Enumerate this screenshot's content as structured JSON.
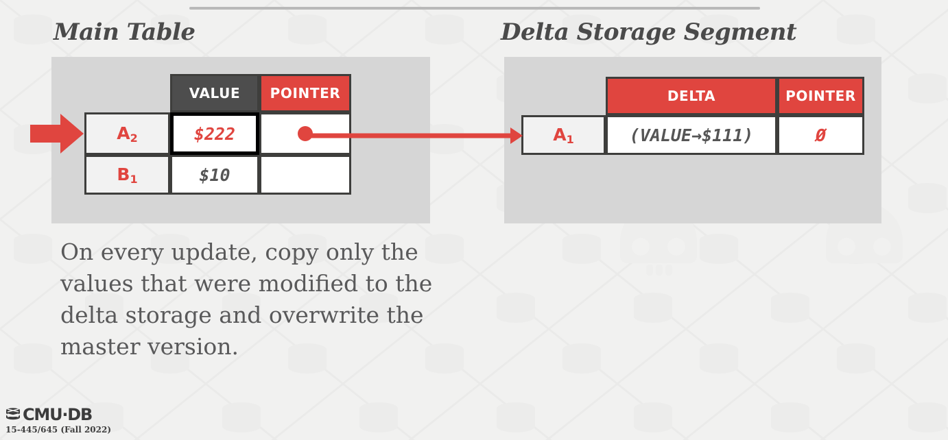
{
  "slide": {
    "footer_wordmark": "CMU·DB",
    "footer_course": "15-445/645 (Fall 2022)",
    "body_text": "On every update, copy only the values that were modified to the delta storage and overwrite the master version."
  },
  "main_table": {
    "title": "Main Table",
    "headers": [
      "",
      "VALUE",
      "POINTER"
    ],
    "rows": [
      {
        "key": "A",
        "key_sub": "2",
        "value": "$222",
        "pointer": "dot"
      },
      {
        "key": "B",
        "key_sub": "1",
        "value": "$10",
        "pointer": ""
      }
    ]
  },
  "delta_table": {
    "title": "Delta Storage Segment",
    "headers": [
      "",
      "DELTA",
      "POINTER"
    ],
    "rows": [
      {
        "key": "A",
        "key_sub": "1",
        "delta": "(VALUE→$111)",
        "pointer": "Ø"
      }
    ]
  },
  "colors": {
    "accent_red": "#e0453f",
    "header_dark": "#4d4d4d",
    "panel_gray": "#d6d6d6",
    "slide_bg": "#f1f1f0",
    "border_dark": "#3e3e3c",
    "text_gray": "#59595a"
  }
}
